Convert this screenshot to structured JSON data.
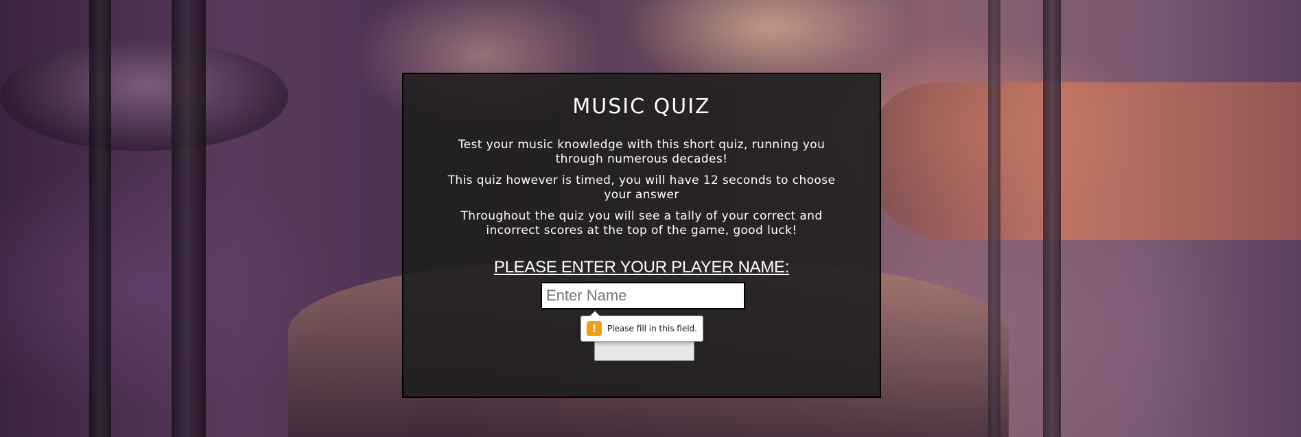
{
  "quiz": {
    "title": "MUSIC QUIZ",
    "intro": [
      "Test your music knowledge with this short quiz, running you through numerous decades!",
      "This quiz however is timed, you will have 12 seconds to choose your answer",
      "Throughout the quiz you will see a tally of your correct and incorrect scores at the top of the game, good luck!"
    ],
    "prompt": "PLEASE ENTER YOUR PLAYER NAME:",
    "name_input": {
      "placeholder": "Enter Name",
      "value": ""
    },
    "start_button": {
      "label": ""
    },
    "validation_tooltip": {
      "icon": "warning-icon",
      "message": "Please fill in this field."
    }
  },
  "colors": {
    "card_background": "#1e1e1e",
    "text": "#ffffff",
    "warning_icon": "#f29d12"
  }
}
